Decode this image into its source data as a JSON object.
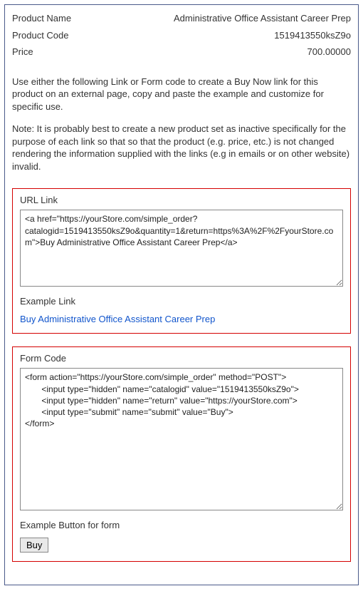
{
  "info": {
    "product_name_label": "Product Name",
    "product_name_value": "Administrative Office Assistant Career Prep",
    "product_code_label": "Product Code",
    "product_code_value": "1519413550ksZ9o",
    "price_label": "Price",
    "price_value": "700.00000"
  },
  "instructions_text": "Use either the following Link or Form code to create a Buy Now link for this product on an external page, copy and paste the example and customize for specific use.",
  "note_text": "Note: It is probably best to create a new product set as inactive specifically for the purpose of each link so that so that the product (e.g. price, etc.) is not changed rendering the information supplied with the links (e.g in emails or on other website) invalid.",
  "url_section": {
    "heading": "URL Link",
    "textarea_value": "<a href=\"https://yourStore.com/simple_order?catalogid=1519413550ksZ9o&quantity=1&return=https%3A%2F%2FyourStore.com\">Buy Administrative Office Assistant Career Prep</a>",
    "example_label": "Example Link",
    "example_link_text": "Buy Administrative Office Assistant Career Prep"
  },
  "form_section": {
    "heading": "Form Code",
    "textarea_value": "<form action=\"https://yourStore.com/simple_order\" method=\"POST\">\n       <input type=\"hidden\" name=\"catalogid\" value=\"1519413550ksZ9o\">\n       <input type=\"hidden\" name=\"return\" value=\"https://yourStore.com\">\n       <input type=\"submit\" name=\"submit\" value=\"Buy\">\n</form>",
    "example_label": "Example Button for form",
    "buy_button_label": "Buy"
  }
}
